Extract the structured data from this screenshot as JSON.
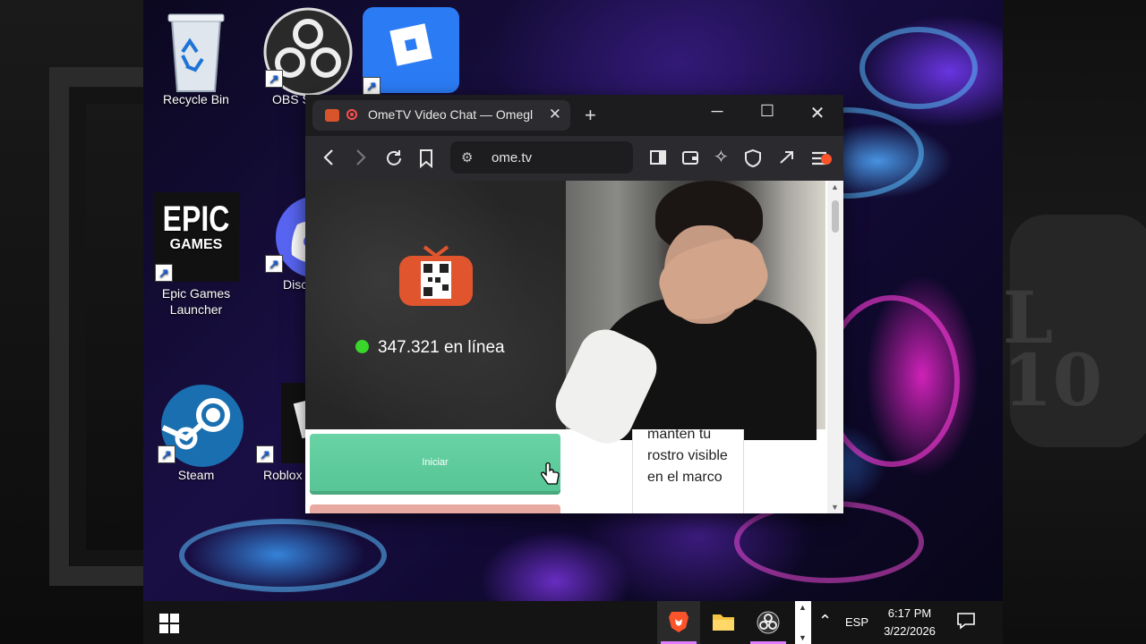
{
  "desktop": {
    "icons": [
      {
        "label": "Recycle Bin"
      },
      {
        "label": "OBS S"
      },
      {
        "label": ""
      },
      {
        "label": "Epic Games Launcher",
        "logo_top": "EPIC",
        "logo_bottom": "GAMES"
      },
      {
        "label": "Disc"
      },
      {
        "label": "Steam"
      },
      {
        "label": "Roblox"
      }
    ],
    "right_deco_text": "L\n10"
  },
  "browser": {
    "tab_title": "OmeTV Video Chat — Omegl",
    "url": "ome.tv",
    "toolbar_icons": [
      "back-icon",
      "forward-icon",
      "reload-icon",
      "bookmark-icon",
      "sidebar-icon",
      "wallet-icon",
      "leo-ai-icon",
      "shield-icon",
      "vpn-icon",
      "menu-icon"
    ]
  },
  "page": {
    "online_count": "347.321 en línea",
    "start_button": "Iniciar",
    "hint": "manten tu rostro visible en el marco"
  },
  "taskbar": {
    "language": "ESP",
    "time": "6:17 PM",
    "date": "3/22/2026"
  },
  "colors": {
    "start_green": "#5fcb9c",
    "online_dot": "#39d62b",
    "accent_pink": "#e07cff"
  }
}
